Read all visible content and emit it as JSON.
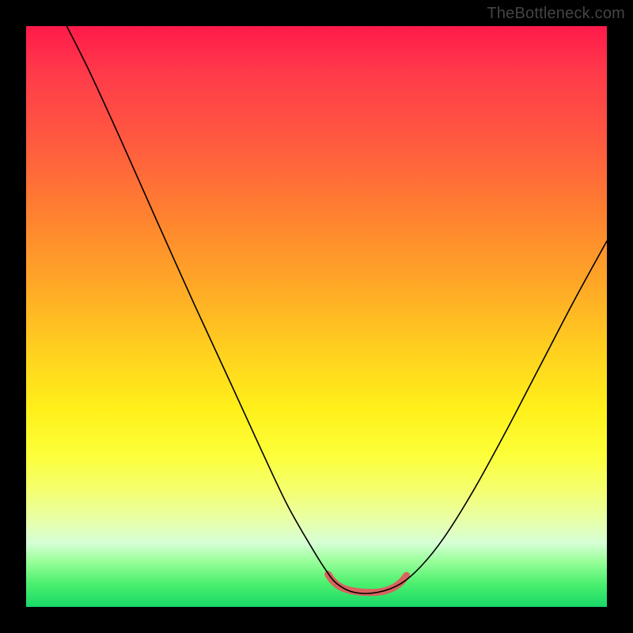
{
  "watermark": "TheBottleneck.com",
  "chart_data": {
    "type": "line",
    "title": "",
    "xlabel": "",
    "ylabel": "",
    "x_range_normalized": [
      0,
      1
    ],
    "y_range_normalized": [
      0,
      1
    ],
    "note": "Axes and tick labels are not shown; values are given in normalized plot coordinates (0–1, origin top-left of gradient area).",
    "series": [
      {
        "name": "black-curve",
        "color": "#000000",
        "points": [
          {
            "x": 0.07,
            "y": 0.0
          },
          {
            "x": 0.11,
            "y": 0.08
          },
          {
            "x": 0.165,
            "y": 0.2
          },
          {
            "x": 0.225,
            "y": 0.335
          },
          {
            "x": 0.29,
            "y": 0.48
          },
          {
            "x": 0.35,
            "y": 0.61
          },
          {
            "x": 0.405,
            "y": 0.73
          },
          {
            "x": 0.45,
            "y": 0.825
          },
          {
            "x": 0.49,
            "y": 0.895
          },
          {
            "x": 0.515,
            "y": 0.935
          },
          {
            "x": 0.535,
            "y": 0.96
          },
          {
            "x": 0.565,
            "y": 0.975
          },
          {
            "x": 0.605,
            "y": 0.975
          },
          {
            "x": 0.645,
            "y": 0.96
          },
          {
            "x": 0.68,
            "y": 0.93
          },
          {
            "x": 0.72,
            "y": 0.88
          },
          {
            "x": 0.77,
            "y": 0.8
          },
          {
            "x": 0.825,
            "y": 0.7
          },
          {
            "x": 0.885,
            "y": 0.585
          },
          {
            "x": 0.945,
            "y": 0.47
          },
          {
            "x": 1.0,
            "y": 0.37
          }
        ]
      },
      {
        "name": "red-flat-segment",
        "color": "#d9635e",
        "stroke_width_px": 9,
        "points": [
          {
            "x": 0.52,
            "y": 0.944
          },
          {
            "x": 0.528,
            "y": 0.955
          },
          {
            "x": 0.54,
            "y": 0.965
          },
          {
            "x": 0.56,
            "y": 0.972
          },
          {
            "x": 0.585,
            "y": 0.975
          },
          {
            "x": 0.61,
            "y": 0.974
          },
          {
            "x": 0.63,
            "y": 0.968
          },
          {
            "x": 0.645,
            "y": 0.958
          },
          {
            "x": 0.655,
            "y": 0.946
          }
        ]
      }
    ],
    "background": {
      "type": "vertical-gradient",
      "description": "Red at top transitioning through orange, yellow, pale yellow/white, to green at bottom"
    }
  }
}
